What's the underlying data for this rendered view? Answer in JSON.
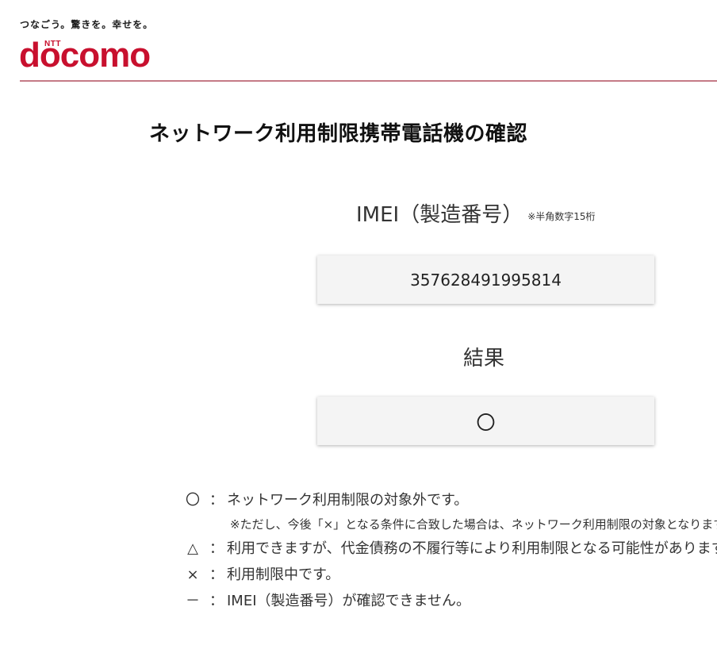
{
  "header": {
    "tagline": "つなごう。驚きを。幸せを。",
    "logo_small": "NTT",
    "logo_text": "docomo"
  },
  "page_title": "ネットワーク利用制限携帯電話機の確認",
  "imei_section": {
    "label": "IMEI（製造番号）",
    "note": "※半角数字15桁",
    "value": "357628491995814"
  },
  "result_section": {
    "label": "結果",
    "value": "〇"
  },
  "legend": {
    "items": [
      {
        "symbol": "〇",
        "colon": "：",
        "text": "ネットワーク利用制限の対象外です。"
      },
      {
        "symbol": "△",
        "colon": "：",
        "text": "利用できますが、代金債務の不履行等により利用制限となる可能性があります。"
      },
      {
        "symbol": "×",
        "colon": "：",
        "text": "利用制限中です。"
      },
      {
        "symbol": "－",
        "colon": "：",
        "text": "IMEI（製造番号）が確認できません。"
      }
    ],
    "note": "※ただし、今後「×」となる条件に合致した場合は、ネットワーク利用制限の対象となります。"
  },
  "colors": {
    "brand": "#c8102e",
    "rule": "#c57a86",
    "field_bg": "#f4f4f4"
  }
}
